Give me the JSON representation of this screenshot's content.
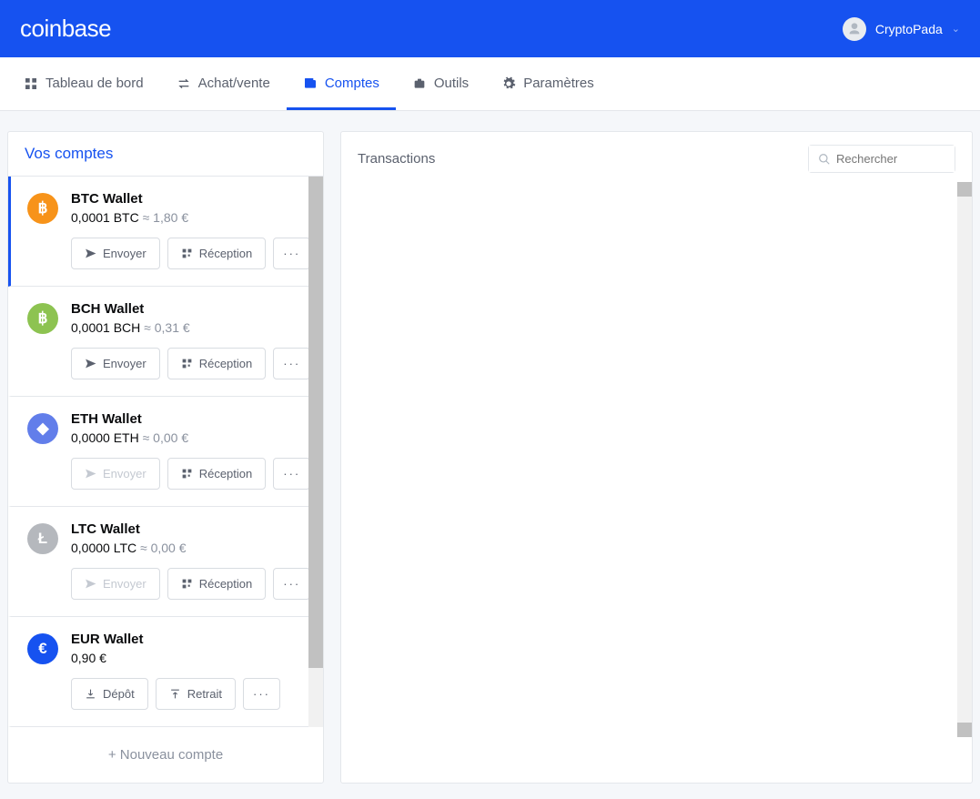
{
  "brand": "coinbase",
  "user": {
    "name": "CryptoPada"
  },
  "nav": {
    "items": [
      {
        "label": "Tableau de bord",
        "icon": "dashboard"
      },
      {
        "label": "Achat/vente",
        "icon": "swap"
      },
      {
        "label": "Comptes",
        "icon": "wallet",
        "active": true
      },
      {
        "label": "Outils",
        "icon": "tools"
      },
      {
        "label": "Paramètres",
        "icon": "settings"
      }
    ]
  },
  "sidebar": {
    "title": "Vos comptes",
    "new_account_label": "Nouveau compte",
    "button_labels": {
      "send": "Envoyer",
      "receive": "Réception",
      "deposit": "Dépôt",
      "withdraw": "Retrait",
      "more": "···"
    },
    "accounts": [
      {
        "name": "BTC Wallet",
        "amount": "0,0001 BTC",
        "approx": "1,80 €",
        "icon_color": "#f7931a",
        "glyph": "฿",
        "selected": true,
        "actions": [
          "send",
          "receive",
          "more"
        ],
        "send_disabled": false
      },
      {
        "name": "BCH Wallet",
        "amount": "0,0001 BCH",
        "approx": "0,31 €",
        "icon_color": "#8dc351",
        "glyph": "฿",
        "selected": false,
        "actions": [
          "send",
          "receive",
          "more"
        ],
        "send_disabled": false
      },
      {
        "name": "ETH Wallet",
        "amount": "0,0000 ETH",
        "approx": "0,00 €",
        "icon_color": "#627eea",
        "glyph": "◆",
        "selected": false,
        "actions": [
          "send",
          "receive",
          "more"
        ],
        "send_disabled": true
      },
      {
        "name": "LTC Wallet",
        "amount": "0,0000 LTC",
        "approx": "0,00 €",
        "icon_color": "#b5b8bd",
        "glyph": "Ł",
        "selected": false,
        "actions": [
          "send",
          "receive",
          "more"
        ],
        "send_disabled": true
      },
      {
        "name": "EUR Wallet",
        "amount": "0,90 €",
        "approx": "",
        "icon_color": "#1652f0",
        "glyph": "€",
        "selected": false,
        "actions": [
          "deposit",
          "withdraw",
          "more"
        ],
        "send_disabled": false
      }
    ]
  },
  "main": {
    "title": "Transactions",
    "search_placeholder": "Rechercher"
  }
}
